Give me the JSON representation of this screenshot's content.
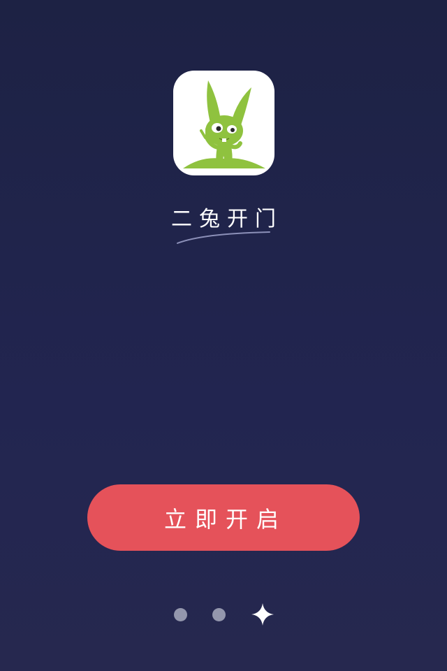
{
  "app": {
    "name": "二兔开门",
    "icon": "rabbit-logo-icon"
  },
  "actions": {
    "start_label": "立即开启"
  },
  "pager": {
    "total_pages": 3,
    "current_page": 3,
    "active_indicator_icon": "sparkle-star-icon"
  },
  "colors": {
    "background": "#1f2347",
    "button": "#e5525a",
    "rabbit_green": "#8fc23f",
    "inactive_dot": "#9497ad"
  }
}
